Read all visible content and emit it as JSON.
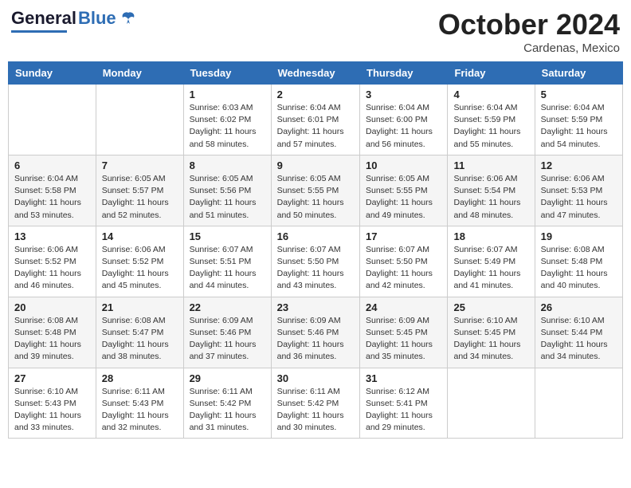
{
  "header": {
    "logo_general": "General",
    "logo_blue": "Blue",
    "month": "October 2024",
    "location": "Cardenas, Mexico"
  },
  "weekdays": [
    "Sunday",
    "Monday",
    "Tuesday",
    "Wednesday",
    "Thursday",
    "Friday",
    "Saturday"
  ],
  "weeks": [
    [
      {
        "day": "",
        "info": ""
      },
      {
        "day": "",
        "info": ""
      },
      {
        "day": "1",
        "info": "Sunrise: 6:03 AM\nSunset: 6:02 PM\nDaylight: 11 hours and 58 minutes."
      },
      {
        "day": "2",
        "info": "Sunrise: 6:04 AM\nSunset: 6:01 PM\nDaylight: 11 hours and 57 minutes."
      },
      {
        "day": "3",
        "info": "Sunrise: 6:04 AM\nSunset: 6:00 PM\nDaylight: 11 hours and 56 minutes."
      },
      {
        "day": "4",
        "info": "Sunrise: 6:04 AM\nSunset: 5:59 PM\nDaylight: 11 hours and 55 minutes."
      },
      {
        "day": "5",
        "info": "Sunrise: 6:04 AM\nSunset: 5:59 PM\nDaylight: 11 hours and 54 minutes."
      }
    ],
    [
      {
        "day": "6",
        "info": "Sunrise: 6:04 AM\nSunset: 5:58 PM\nDaylight: 11 hours and 53 minutes."
      },
      {
        "day": "7",
        "info": "Sunrise: 6:05 AM\nSunset: 5:57 PM\nDaylight: 11 hours and 52 minutes."
      },
      {
        "day": "8",
        "info": "Sunrise: 6:05 AM\nSunset: 5:56 PM\nDaylight: 11 hours and 51 minutes."
      },
      {
        "day": "9",
        "info": "Sunrise: 6:05 AM\nSunset: 5:55 PM\nDaylight: 11 hours and 50 minutes."
      },
      {
        "day": "10",
        "info": "Sunrise: 6:05 AM\nSunset: 5:55 PM\nDaylight: 11 hours and 49 minutes."
      },
      {
        "day": "11",
        "info": "Sunrise: 6:06 AM\nSunset: 5:54 PM\nDaylight: 11 hours and 48 minutes."
      },
      {
        "day": "12",
        "info": "Sunrise: 6:06 AM\nSunset: 5:53 PM\nDaylight: 11 hours and 47 minutes."
      }
    ],
    [
      {
        "day": "13",
        "info": "Sunrise: 6:06 AM\nSunset: 5:52 PM\nDaylight: 11 hours and 46 minutes."
      },
      {
        "day": "14",
        "info": "Sunrise: 6:06 AM\nSunset: 5:52 PM\nDaylight: 11 hours and 45 minutes."
      },
      {
        "day": "15",
        "info": "Sunrise: 6:07 AM\nSunset: 5:51 PM\nDaylight: 11 hours and 44 minutes."
      },
      {
        "day": "16",
        "info": "Sunrise: 6:07 AM\nSunset: 5:50 PM\nDaylight: 11 hours and 43 minutes."
      },
      {
        "day": "17",
        "info": "Sunrise: 6:07 AM\nSunset: 5:50 PM\nDaylight: 11 hours and 42 minutes."
      },
      {
        "day": "18",
        "info": "Sunrise: 6:07 AM\nSunset: 5:49 PM\nDaylight: 11 hours and 41 minutes."
      },
      {
        "day": "19",
        "info": "Sunrise: 6:08 AM\nSunset: 5:48 PM\nDaylight: 11 hours and 40 minutes."
      }
    ],
    [
      {
        "day": "20",
        "info": "Sunrise: 6:08 AM\nSunset: 5:48 PM\nDaylight: 11 hours and 39 minutes."
      },
      {
        "day": "21",
        "info": "Sunrise: 6:08 AM\nSunset: 5:47 PM\nDaylight: 11 hours and 38 minutes."
      },
      {
        "day": "22",
        "info": "Sunrise: 6:09 AM\nSunset: 5:46 PM\nDaylight: 11 hours and 37 minutes."
      },
      {
        "day": "23",
        "info": "Sunrise: 6:09 AM\nSunset: 5:46 PM\nDaylight: 11 hours and 36 minutes."
      },
      {
        "day": "24",
        "info": "Sunrise: 6:09 AM\nSunset: 5:45 PM\nDaylight: 11 hours and 35 minutes."
      },
      {
        "day": "25",
        "info": "Sunrise: 6:10 AM\nSunset: 5:45 PM\nDaylight: 11 hours and 34 minutes."
      },
      {
        "day": "26",
        "info": "Sunrise: 6:10 AM\nSunset: 5:44 PM\nDaylight: 11 hours and 34 minutes."
      }
    ],
    [
      {
        "day": "27",
        "info": "Sunrise: 6:10 AM\nSunset: 5:43 PM\nDaylight: 11 hours and 33 minutes."
      },
      {
        "day": "28",
        "info": "Sunrise: 6:11 AM\nSunset: 5:43 PM\nDaylight: 11 hours and 32 minutes."
      },
      {
        "day": "29",
        "info": "Sunrise: 6:11 AM\nSunset: 5:42 PM\nDaylight: 11 hours and 31 minutes."
      },
      {
        "day": "30",
        "info": "Sunrise: 6:11 AM\nSunset: 5:42 PM\nDaylight: 11 hours and 30 minutes."
      },
      {
        "day": "31",
        "info": "Sunrise: 6:12 AM\nSunset: 5:41 PM\nDaylight: 11 hours and 29 minutes."
      },
      {
        "day": "",
        "info": ""
      },
      {
        "day": "",
        "info": ""
      }
    ]
  ]
}
